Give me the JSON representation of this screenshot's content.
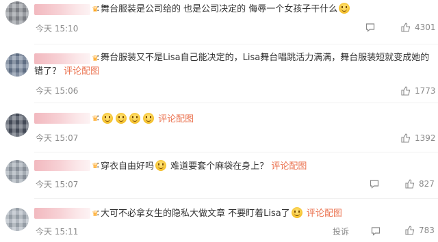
{
  "comments": [
    {
      "text": "舞台服装是公司给的 也是公司决定的 侮辱一个女孩子干什么",
      "time": "今天 15:10",
      "likes": "4301",
      "trailing_emoji": "sweat-smile"
    },
    {
      "text": "舞台服装又不是Lisa自己能决定的，Lisa舞台唱跳活力满满，舞台服装短就变成她的",
      "text_line2": "错了？",
      "link": "评论配图",
      "time": "今天 15:06",
      "likes": "1773"
    },
    {
      "emoji_count": 4,
      "link": "评论配图",
      "time": "今天 15:07",
      "likes": "1392"
    },
    {
      "text_a": "穿衣自由好吗",
      "text_b": "难道要套个麻袋在身上？",
      "link": "评论配图",
      "time": "今天 15:07",
      "likes": "827"
    },
    {
      "text": "大可不必拿女生的隐私大做文章 不要盯着Lisa了",
      "link": "评论配图",
      "time": "今天 15:11",
      "report": "投诉",
      "likes": "783"
    }
  ],
  "colors": {
    "link": "#eb7350",
    "meta": "#8a8a8a",
    "vip": "#ff9a00"
  }
}
